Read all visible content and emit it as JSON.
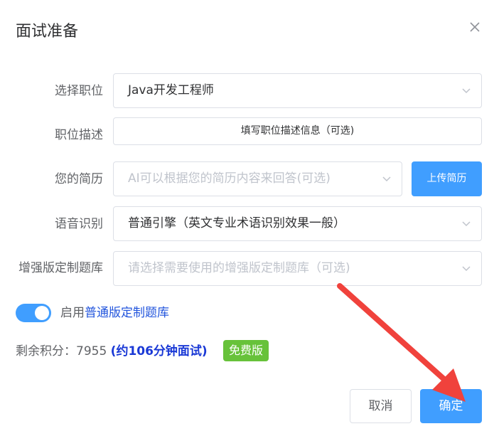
{
  "dialog": {
    "title": "面试准备",
    "close_icon": "close-icon"
  },
  "form": {
    "position": {
      "label": "选择职位",
      "value": "Java开发工程师"
    },
    "description": {
      "label": "职位描述",
      "button_label": "填写职位描述信息（可选)"
    },
    "resume": {
      "label": "您的简历",
      "placeholder": "AI可以根据您的简历内容来回答(可选)",
      "upload_label": "上传简历"
    },
    "speech": {
      "label": "语音识别",
      "value": "普通引擎（英文专业术语识别效果一般）"
    },
    "question_bank": {
      "label": "增强版定制题库",
      "placeholder": "请选择需要使用的增强版定制题库（可选)"
    }
  },
  "toggle": {
    "enabled": true,
    "prefix": "启用",
    "link_text": "普通版定制题库"
  },
  "points": {
    "label": "剩余积分：",
    "value": "7955",
    "estimate": "(约106分钟面试)",
    "badge": "免费版"
  },
  "footer": {
    "cancel_label": "取消",
    "confirm_label": "确定"
  },
  "colors": {
    "primary": "#409eff",
    "success": "#67c23a",
    "annotation_arrow": "#f0423c"
  }
}
